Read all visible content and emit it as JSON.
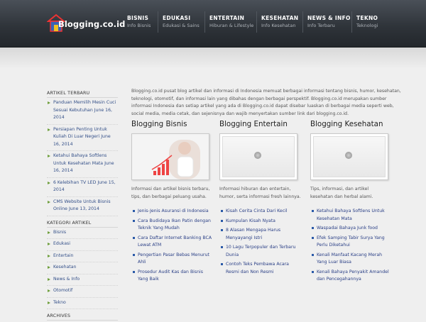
{
  "brand": {
    "logo_text": "Blogging.co.id",
    "accent": "#6d9e3a"
  },
  "nav": [
    {
      "title": "BISNIS",
      "sub": "Info Bisnis"
    },
    {
      "title": "EDUKASI",
      "sub": "Edukasi & Sains"
    },
    {
      "title": "ENTERTAIN",
      "sub": "Hiburan & Lifestyle"
    },
    {
      "title": "KESEHATAN",
      "sub": "Info Kesehatan"
    },
    {
      "title": "NEWS & INFO",
      "sub": "Info Terbaru"
    },
    {
      "title": "TEKNO",
      "sub": "Teknologi"
    }
  ],
  "sidebar": {
    "recent_heading": "ARTIKEL TERBARU",
    "recent": [
      {
        "title": "Panduan Memilih Mesin Cuci Sesuai Kebutuhan",
        "date": "June 16, 2014"
      },
      {
        "title": "Persiapan Penting Untuk Kuliah Di Luar Negeri",
        "date": "June 16, 2014"
      },
      {
        "title": "Ketahui Bahaya Softlens Untuk Kesehatan Mata",
        "date": "June 16, 2014"
      },
      {
        "title": "6 Kelebihan TV LED",
        "date": "June 15, 2014"
      },
      {
        "title": "CMS Website Untuk Bisnis Online",
        "date": "June 13, 2014"
      }
    ],
    "categories_heading": "KATEGORI ARTIKEL",
    "categories": [
      "Bisnis",
      "Edukasi",
      "Entertain",
      "Kesehatan",
      "News & Info",
      "Otomotif",
      "Tekno"
    ],
    "archives_heading": "ARCHIVES"
  },
  "main": {
    "intro": "Blogging.co.id pusat blog artikel dan informasi di Indonesia memuat berbagai informasi tentang bisnis, humor, kesehatan, teknologi, otomotif, dan informasi lain yang dibahas dengan berbagai perspektif. Blogging.co.id merupakan sumber informasi Indonesia dan setiap artikel yang ada di Blogging.co.id dapat disebar luaskan di berbagai media seperti web, social media, media cetak, dan sejenisnya dan wajib menyertakan sumber link dari blogging.co.id.",
    "columns": [
      {
        "heading": "Blogging Bisnis",
        "desc": "Informasi dan artikel bisnis terbaru, tips, dan berbagai peluang usaha.",
        "links": [
          "Jenis-Jenis Asuransi di Indonesia",
          "Cara Budidaya Ikan Patin dengan Teknik Yang Mudah",
          "Cara Daftar Internet Banking BCA Lewat ATM",
          "Pengertian Pasar Bebas Menurut Ahli",
          "Prosedur Audit Kas dan Bisnis Yang Baik"
        ]
      },
      {
        "heading": "Blogging Entertain",
        "desc": "Informasi hiburan dan entertain, humor, serta informasi fresh lainnya.",
        "links": [
          "Kisah Cerita Cinta Dari Kecil",
          "Kumpulan Kisah Nyata",
          "8 Alasan Mengapa Harus Menyayangi Istri",
          "10 Lagu Terpopuler dan Terbaru Dunia",
          "Contoh Teks Pembawa Acara Resmi dan Non Resmi"
        ]
      },
      {
        "heading": "Blogging Kesehatan",
        "desc": "Tips, informasi, dan artikel kesehatan dan herbal alami.",
        "links": [
          "Ketahui Bahaya Softlens Untuk Kesehatan Mata",
          "Waspadai Bahaya Junk food",
          "Efek Samping Tabir Surya Yang Perlu Diketahui",
          "Kenali Manfaat Kacang Merah Yang Luar Biasa",
          "Kenali Bahaya Penyakit Amandel dan Pencegahannya"
        ]
      }
    ]
  }
}
